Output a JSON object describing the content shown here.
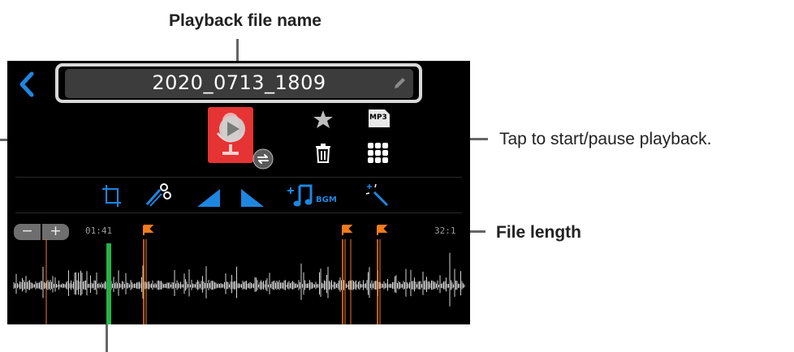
{
  "callouts": {
    "file_name_label": "Playback file name",
    "play_tap_label": "Tap to start/pause playback.",
    "file_length_label": "File length"
  },
  "player": {
    "file_name": "2020_0713_1809",
    "format_badge": "MP3",
    "current_time": "01:41",
    "total_time": "32:1",
    "zoom_out": "−",
    "zoom_in": "+",
    "bgm_label": "BGM",
    "playhead_fraction": 0.21,
    "markers_fraction": [
      0.295,
      0.725,
      0.8
    ]
  },
  "colors": {
    "accent_blue": "#1f86e0",
    "marker_orange": "#f47a1f",
    "playhead_green": "#27b24a",
    "play_tile_red": "#e63333"
  },
  "icons": {
    "back": "chevron-left-icon",
    "edit": "pencil-icon",
    "favorite": "star-icon",
    "delete": "trash-icon",
    "menu": "grid-icon",
    "trim": "trim-icon",
    "divide": "scissors-icon",
    "fade_in": "fade-in-icon",
    "fade_out": "fade-out-icon",
    "bgm": "bgm-icon",
    "effect": "magic-wand-icon"
  }
}
